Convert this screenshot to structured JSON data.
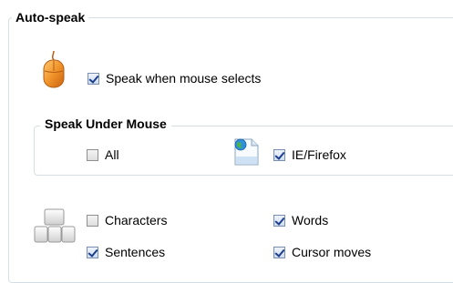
{
  "group": {
    "title": "Auto-speak",
    "speak_when_mouse_selects": {
      "label": "Speak when mouse selects",
      "checked": true
    }
  },
  "speak_under_mouse": {
    "title": "Speak Under Mouse",
    "all": {
      "label": "All",
      "checked": false
    },
    "ie_firefox": {
      "label": "IE/Firefox",
      "checked": true
    }
  },
  "options": {
    "characters": {
      "label": "Characters",
      "checked": false
    },
    "words": {
      "label": "Words",
      "checked": true
    },
    "sentences": {
      "label": "Sentences",
      "checked": true
    },
    "cursor_moves": {
      "label": "Cursor moves",
      "checked": true
    }
  },
  "icons": {
    "mouse": "mouse-icon",
    "web_page": "web-page-icon",
    "keyboard": "keyboard-keys-icon"
  },
  "colors": {
    "group_border": "#d5dfe5",
    "mouse_orange": "#f0942a",
    "check_mark": "#1c3f8c"
  }
}
